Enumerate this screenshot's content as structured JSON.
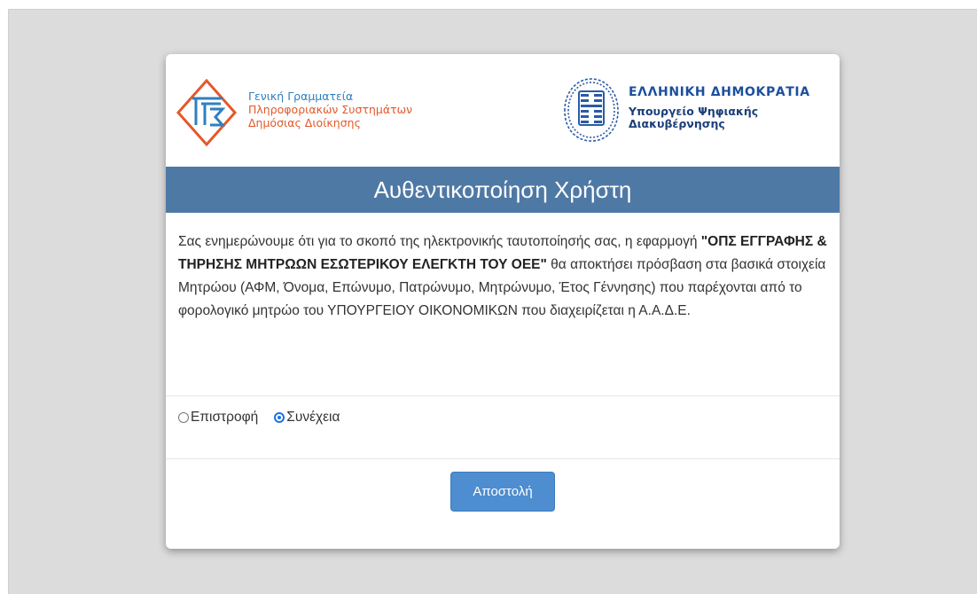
{
  "branding": {
    "gsis": {
      "line1": "Γενική Γραμματεία",
      "line2": "Πληροφοριακών Συστημάτων",
      "line3": "Δημόσιας Διοίκησης"
    },
    "gov": {
      "line1": "ΕΛΛΗΝΙΚΗ ΔΗΜΟΚΡΑΤΙΑ",
      "line2": "Υπουργείο Ψηφιακής",
      "line3": "Διακυβέρνησης"
    }
  },
  "title": "Αυθεντικοποίηση Χρήστη",
  "notice": {
    "before": "Σας ενημερώνουμε ότι για το σκοπό της ηλεκτρονικής ταυτοποίησής σας, η εφαρμογή ",
    "app_name": "\"ΟΠΣ ΕΓΓΡΑΦΗΣ & ΤΗΡΗΣΗΣ ΜΗΤΡΩΩΝ ΕΣΩΤΕΡΙΚΟΥ ΕΛΕΓΚΤΗ ΤΟΥ ΟΕΕ\"",
    "after": " θα αποκτήσει πρόσβαση στα βασικά στοιχεία Μητρώου (ΑΦΜ, Όνομα, Επώνυμο, Πατρώνυμο, Μητρώνυμο, Έτος Γέννησης) που παρέχονται από το φορολογικό μητρώο του ΥΠΟΥΡΓΕΙΟΥ ΟΙΚΟΝΟΜΙΚΩΝ που διαχειρίζεται η Α.Α.Δ.Ε."
  },
  "options": [
    {
      "label": "Επιστροφή",
      "checked": false
    },
    {
      "label": "Συνέχεια",
      "checked": true
    }
  ],
  "submit_label": "Αποστολή",
  "colors": {
    "header_bar": "#4f79a5",
    "button": "#4d8dd0",
    "gsis_blue": "#2f7fc1",
    "gsis_orange": "#e3592a",
    "gov_blue": "#1c4f9c"
  }
}
